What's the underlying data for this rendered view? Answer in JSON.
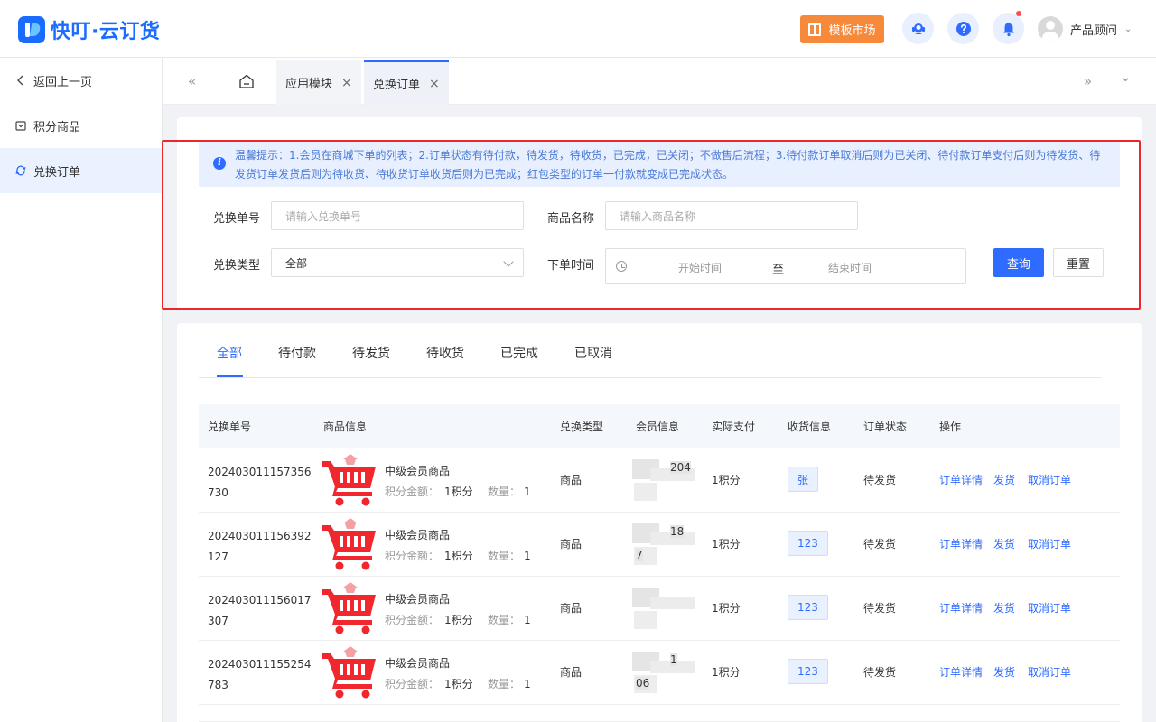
{
  "header": {
    "app_name": "快叮·云订货",
    "template_market": "模板市场",
    "user_name": "产品顾问"
  },
  "sidebar": {
    "items": [
      {
        "label": "返回上一页"
      },
      {
        "label": "积分商品"
      },
      {
        "label": "兑换订单"
      }
    ]
  },
  "page_tabs": [
    {
      "label": "应用模块",
      "close": "×"
    },
    {
      "label": "兑换订单",
      "close": "×"
    }
  ],
  "tab_nav": {
    "left": "«",
    "right": "»",
    "more": "⌄"
  },
  "notice": {
    "text": "温馨提示：1.会员在商城下单的列表；2.订单状态有待付款，待发货，待收货，已完成，已关闭；不做售后流程；3.待付款订单取消后则为已关闭、待付款订单支付后则为待发货、待发货订单发货后则为待收货、待收货订单收货后则为已完成；红包类型的订单一付款就变成已完成状态。"
  },
  "filters": {
    "order_no_label": "兑换单号",
    "order_no_placeholder": "请输入兑换单号",
    "product_label": "商品名称",
    "product_placeholder": "请输入商品名称",
    "type_label": "兑换类型",
    "type_value": "全部",
    "time_label": "下单时间",
    "start_placeholder": "开始时间",
    "range_sep": "至",
    "end_placeholder": "结束时间",
    "search_button": "查询",
    "reset_button": "重置"
  },
  "status_tabs": [
    {
      "label": "全部"
    },
    {
      "label": "待付款"
    },
    {
      "label": "待发货"
    },
    {
      "label": "待收货"
    },
    {
      "label": "已完成"
    },
    {
      "label": "已取消"
    }
  ],
  "table": {
    "headers": {
      "order_no": "兑换单号",
      "product": "商品信息",
      "type": "兑换类型",
      "member": "会员信息",
      "paid": "实际支付",
      "shipping": "收货信息",
      "status": "订单状态",
      "actions": "操作"
    },
    "labels": {
      "amount": "积分金额：",
      "qty": "数量："
    },
    "actions": {
      "detail": "订单详情",
      "ship": "发货",
      "cancel": "取消订单"
    },
    "rows": [
      {
        "order_no": "202403011157356730",
        "product": "中级会员商品",
        "amount": "1积分",
        "qty": "1",
        "type": "商品",
        "member_a": "204",
        "member_b": "",
        "paid": "1积分",
        "shipping": "张",
        "status": "待发货"
      },
      {
        "order_no": "202403011156392127",
        "product": "中级会员商品",
        "amount": "1积分",
        "qty": "1",
        "type": "商品",
        "member_a": "18",
        "member_b": "7",
        "paid": "1积分",
        "shipping": "123",
        "status": "待发货"
      },
      {
        "order_no": "202403011156017307",
        "product": "中级会员商品",
        "amount": "1积分",
        "qty": "1",
        "type": "商品",
        "member_a": "",
        "member_b": "",
        "paid": "1积分",
        "shipping": "123",
        "status": "待发货"
      },
      {
        "order_no": "202403011155254783",
        "product": "中级会员商品",
        "amount": "1积分",
        "qty": "1",
        "type": "商品",
        "member_a": "1",
        "member_b": "06",
        "paid": "1积分",
        "shipping": "123",
        "status": "待发货"
      }
    ]
  },
  "colors": {
    "primary": "#2f6bff",
    "accent_orange": "#f68a3a",
    "highlight_frame": "#e8282b",
    "cart_red": "#f0282e"
  }
}
